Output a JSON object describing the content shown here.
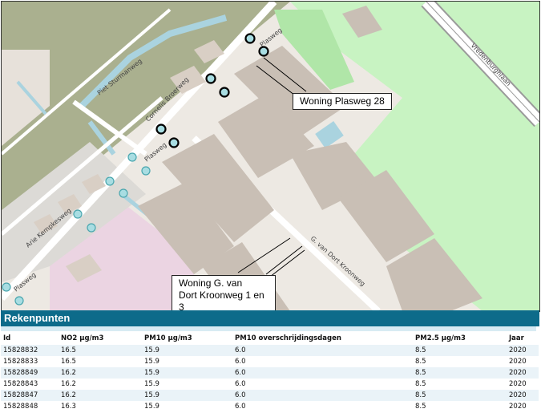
{
  "map": {
    "street_labels": {
      "piet_sturmanweg": "Piet Sturmanweg",
      "cornelis_broerweg": "Cornelis Broerweg",
      "plasweg_top": "Plasweg",
      "plasweg_mid": "Plasweg",
      "plasweg_bottom": "Plasweg",
      "arie_kempkesweg": "Arie Kempkesweg",
      "van_dort_kroonweg": "G. van Dort Kroonweg",
      "vredenburghlaan": "Vredenburghlaan"
    },
    "callouts": {
      "plasweg_28": "Woning Plasweg 28",
      "van_dort_line1": "Woning G. van",
      "van_dort_line2": "Dort Kroonweg 1 en 3"
    },
    "colors": {
      "marker_fill": "#a8dde2",
      "marker_stroke": "#000000",
      "water": "#aad3df",
      "park": "#c8facc",
      "building": "#c9bfb5",
      "industrial": "#d1c5bd"
    }
  },
  "panel": {
    "title": "Rekenpunten"
  },
  "table": {
    "headers": [
      "Id",
      "NO2 μg/m3",
      "PM10 μg/m3",
      "PM10 overschrijdingsdagen",
      "PM2.5 μg/m3",
      "Jaar"
    ],
    "rows": [
      [
        "15828832",
        "16.5",
        "15.9",
        "6.0",
        "8.5",
        "2020"
      ],
      [
        "15828833",
        "16.5",
        "15.9",
        "6.0",
        "8.5",
        "2020"
      ],
      [
        "15828849",
        "16.2",
        "15.9",
        "6.0",
        "8.5",
        "2020"
      ],
      [
        "15828843",
        "16.2",
        "15.9",
        "6.0",
        "8.5",
        "2020"
      ],
      [
        "15828847",
        "16.2",
        "15.9",
        "6.0",
        "8.5",
        "2020"
      ],
      [
        "15828848",
        "16.3",
        "15.9",
        "6.0",
        "8.5",
        "2020"
      ]
    ]
  }
}
